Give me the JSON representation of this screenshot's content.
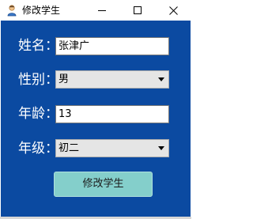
{
  "window": {
    "title": "修改学生",
    "app_icon": "user-app-icon",
    "controls": {
      "minimize_icon": "minimize-icon",
      "maximize_icon": "maximize-icon",
      "close_icon": "close-icon"
    }
  },
  "form": {
    "name": {
      "label": "姓名：",
      "value": "张津广"
    },
    "gender": {
      "label": "性别：",
      "selected": "男"
    },
    "age": {
      "label": "年龄：",
      "value": "13"
    },
    "grade": {
      "label": "年级：",
      "selected": "初二"
    },
    "submit_label": "修改学生"
  },
  "colors": {
    "client_background": "#0b4aa1",
    "button_background": "#84cfcb",
    "label_text": "#ffffff"
  }
}
